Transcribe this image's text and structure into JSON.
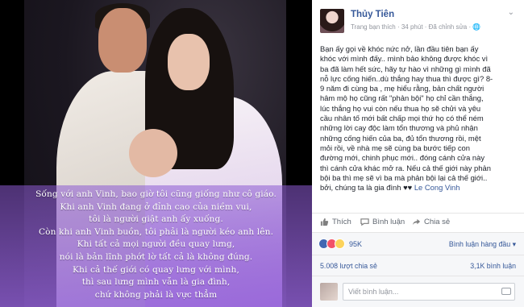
{
  "photo": {
    "quote_lines": [
      "Sống với anh Vinh, bao giờ tôi cũng giống như cô giáo.",
      "Khi anh Vinh đang ở đỉnh cao của niềm vui,",
      "tôi là người giật anh ấy xuống.",
      "Còn khi anh Vinh buồn, tôi phải là người kéo anh lên.",
      "Khi tất cả mọi người đều quay lưng,",
      "nói là bản lĩnh phớt lờ tất cả là không đúng.",
      "Khi cả thế giới có quay lưng với mình,",
      "thì sau lưng mình vẫn là gia đình,",
      "chứ không phải là vực thẳm"
    ]
  },
  "post": {
    "author": "Thủy Tiên",
    "meta": "Trang bạn thích · 34 phút · Đã chỉnh sửa · 🌐",
    "body_lines": [
      "Bạn ấy gọi về khóc nức nở, lần đầu tiên bạn ấy",
      "khóc với mình đấy.. mình bảo không được khóc vì",
      "ba đã làm hết sức, hãy tự hào vì những gì mình đã",
      "nỗ lực cống hiến..dù thắng hay thua thì được gì? 8-",
      "9 năm đi cùng ba , mẹ hiểu rằng, bản chất người",
      "hâm mộ họ cũng rất \"phản bội\" họ chỉ cần thắng,",
      "lúc thắng họ vui còn nếu thua họ sẽ chửi và yêu",
      "cầu nhân tố mới bất chấp mọi thứ họ có thể ném",
      "những lời cay độc làm tổn thương và phủ nhận",
      "những cống hiến của ba, đủ tổn thương rồi, mệt",
      "mỏi rồi, về nhà mẹ sẽ cùng ba bước tiếp con",
      "đường mới, chinh phục mới.. đóng cánh cửa này",
      "thì cánh cửa khác mở ra. Nếu cả thế giới này phản",
      "bội ba thì mẹ sẽ vì ba mà phản bội lại cả thế giới..",
      "bởi, chúng ta là gia đình ♥♥ "
    ],
    "tag": "Le Cong Vinh",
    "actions": {
      "like": "Thích",
      "comment": "Bình luận",
      "share": "Chia sẻ"
    },
    "reactions": {
      "count": "95K",
      "sort": "Bình luận hàng đầu ▾"
    },
    "shares": {
      "left": "5.008 lượt chia sẻ",
      "right": "3,1K bình luận"
    },
    "comment_placeholder": "Viết bình luận..."
  }
}
